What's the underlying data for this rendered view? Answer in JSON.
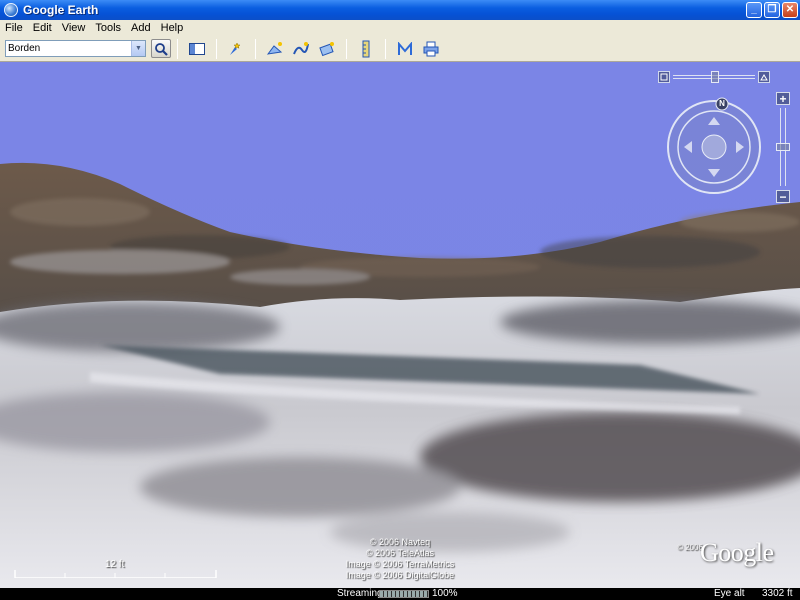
{
  "window": {
    "title": "Google Earth",
    "controls": {
      "minimize": "_",
      "maximize": "❐",
      "close": "✕"
    }
  },
  "menu": {
    "items": [
      "File",
      "Edit",
      "View",
      "Tools",
      "Add",
      "Help"
    ]
  },
  "toolbar": {
    "search_value": "Borden",
    "icons": [
      "sidebar-toggle-icon",
      "placemark-icon",
      "polygon-icon",
      "path-icon",
      "overlay-icon",
      "ruler-icon",
      "email-icon",
      "print-icon"
    ]
  },
  "navigation": {
    "north_label": "N",
    "zoom_in": "+",
    "zoom_out": "−"
  },
  "map": {
    "copyright": [
      "© 2006 Navteq",
      "© 2006 TeleAtlas",
      "Image © 2006 TerraMetrics",
      "Image © 2006 DigitalGlobe"
    ],
    "logo_text": "Google",
    "logo_year": "© 2006",
    "scale_label": "12 ft"
  },
  "status": {
    "streaming_label": "Streaming",
    "streaming_percent": "100%",
    "streaming_progress": 1.0,
    "eye_alt_label": "Eye alt",
    "eye_alt_value": "3302 ft"
  }
}
